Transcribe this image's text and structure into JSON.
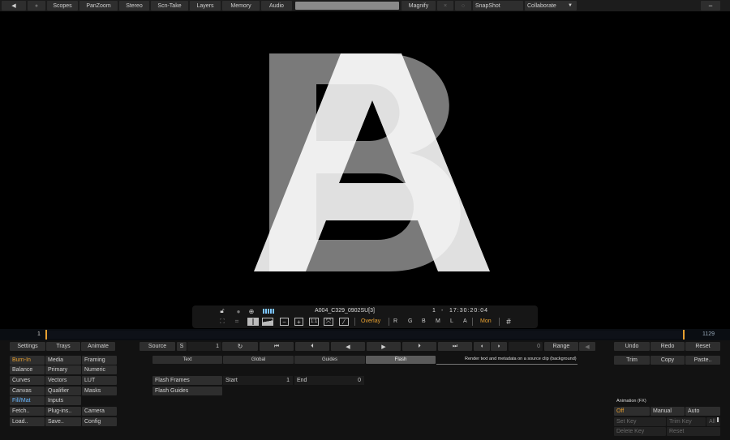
{
  "topbar": {
    "buttons": [
      "Scopes",
      "PanZoom",
      "Stereo",
      "Scn-Take",
      "Layers",
      "Memory",
      "Audio"
    ],
    "magnify": "Magnify",
    "snapshot": "SnapShot",
    "collaborate": "Collaborate",
    "minimize": "−",
    "prev_arrow": "◀",
    "mini_icons": [
      "×",
      "○"
    ]
  },
  "viewer": {
    "overlay_letters": [
      "A",
      "B"
    ],
    "clip_name": "A004_C329_0902SU[3]",
    "clip_index": "1",
    "dash": "-",
    "timecode": "17:30:20:04",
    "mode_labels": {
      "one_to_one": "1:1",
      "overlay": "Overlay",
      "channels": [
        "R",
        "G",
        "B",
        "M",
        "L",
        "A"
      ],
      "mon": "Mon"
    }
  },
  "timeline": {
    "start": "1",
    "end": "1129"
  },
  "panel": {
    "tabs_left": [
      "Settings",
      "Trays",
      "Animate"
    ],
    "source": "Source",
    "s_label": "S",
    "frame_value": "1",
    "frame_counter": "0",
    "range": "Range",
    "undo": "Undo",
    "redo": "Redo",
    "reset": "Reset",
    "trim": "Trim",
    "copy": "Copy",
    "paste": "Paste..",
    "menu_col1": [
      "Burn-In",
      "Balance",
      "Curves",
      "Canvas",
      "Fill/Mat",
      "Fetch..",
      "Load.."
    ],
    "menu_col2": [
      "Media",
      "Primary",
      "Vectors",
      "Qualifier",
      "Inputs",
      "Plug-ins..",
      "Save.."
    ],
    "menu_col3": [
      "Framing",
      "Numeric",
      "LUT",
      "Masks",
      "",
      "Camera",
      "Config"
    ],
    "sub_tabs": [
      "Text",
      "Global",
      "Guides",
      "Flash"
    ],
    "sub_tab_desc": "Render text and metadata on a source clip (background)",
    "flash_rows": [
      "Flash Frames",
      "Flash Guides"
    ],
    "start_label": "Start",
    "start_value": "1",
    "end_label": "End",
    "end_value": "0",
    "animation_title": "Animation (FX)",
    "anim_modes": [
      "Off",
      "Manual",
      "Auto"
    ],
    "set_key": "Set Key",
    "trim_key": "Trim Key",
    "all_key": "All",
    "delete_key": "Delete Key",
    "reset_key": "Reset"
  },
  "colors": {
    "accent_orange": "#e8a030",
    "accent_blue": "#6ab8ff"
  }
}
